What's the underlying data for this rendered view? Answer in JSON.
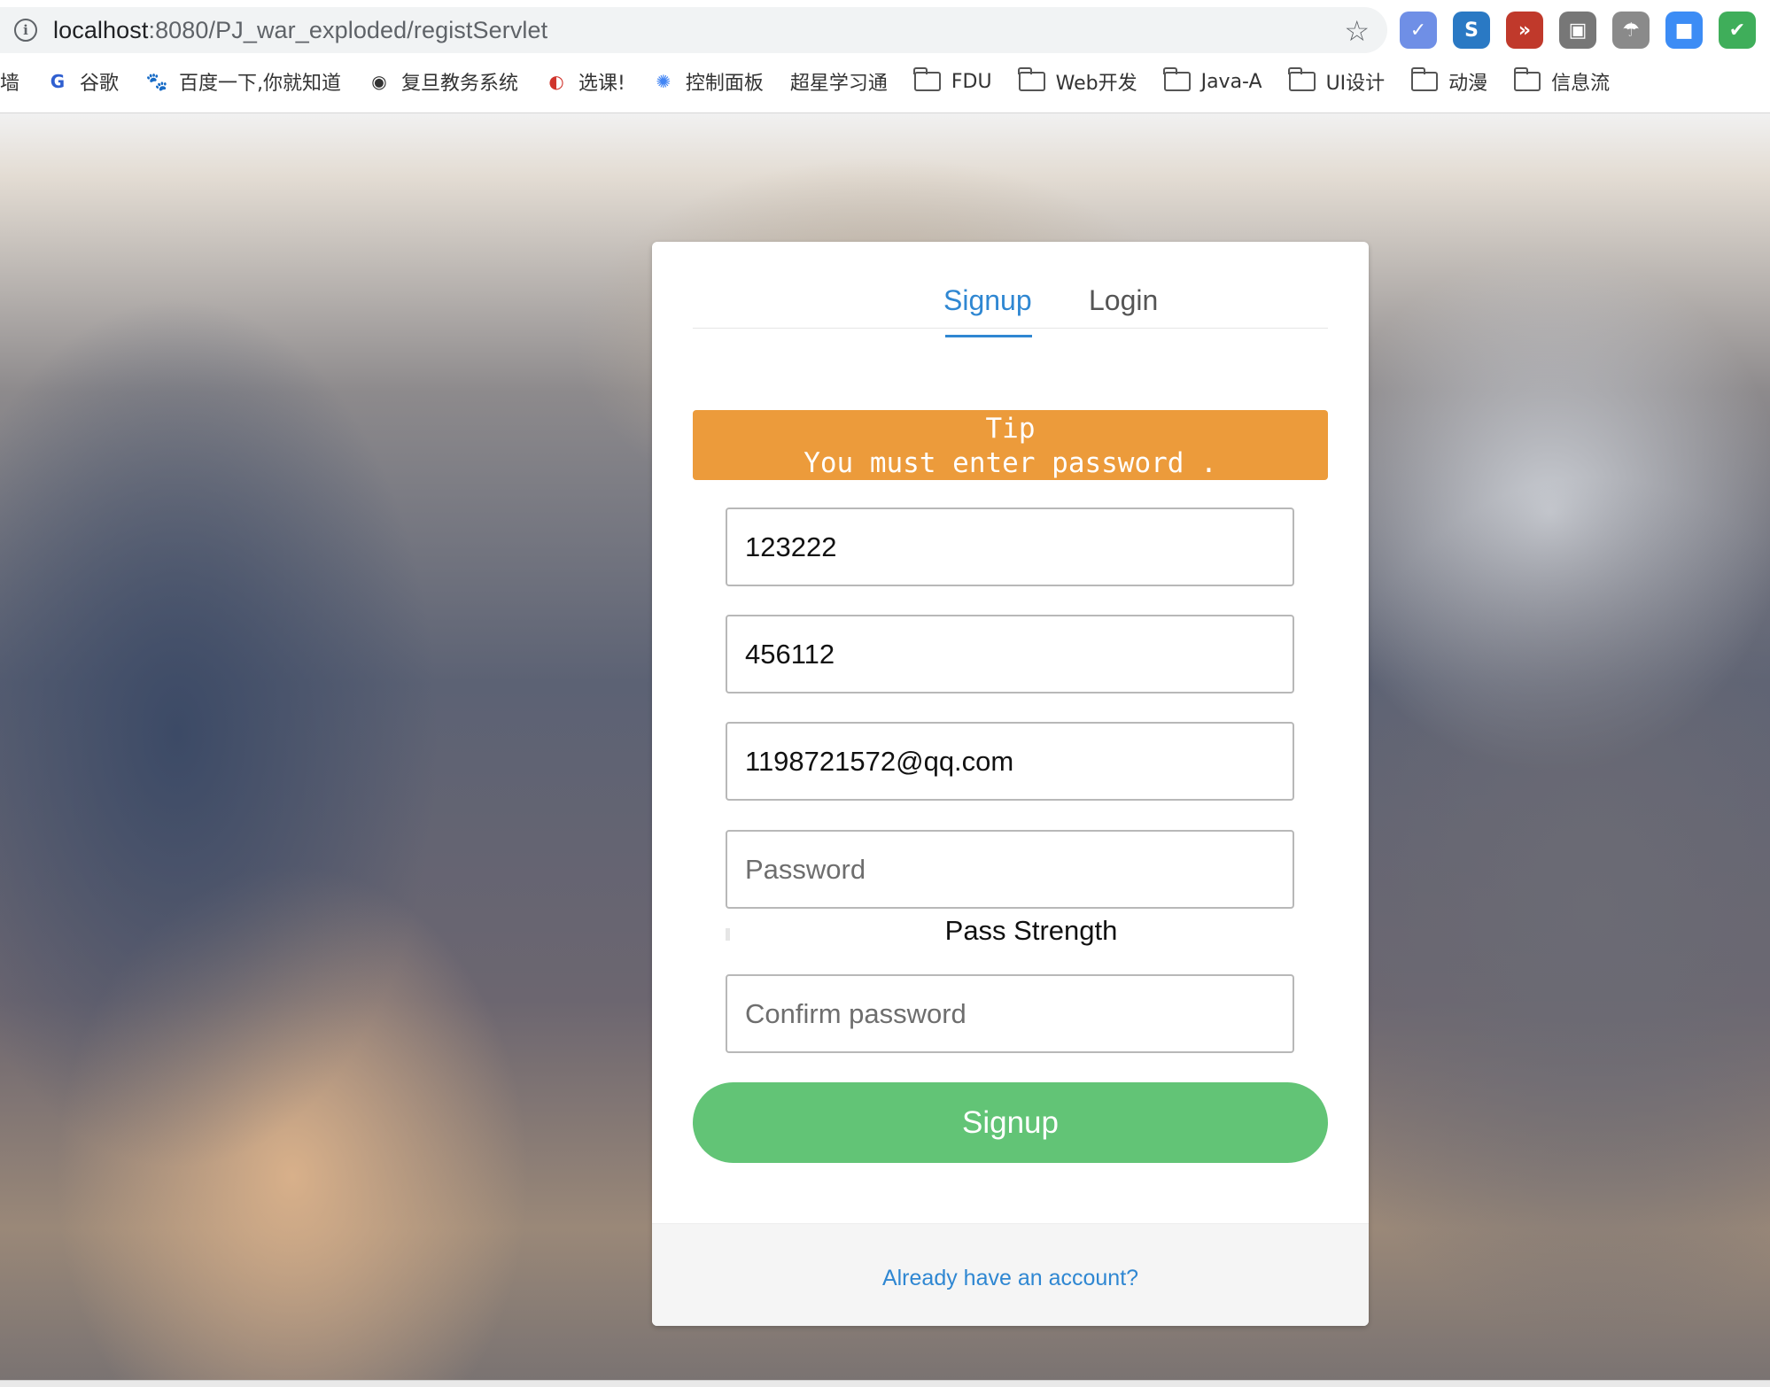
{
  "browser": {
    "url_host": "localhost",
    "url_path": ":8080/PJ_war_exploded/registServlet",
    "extensions": [
      {
        "name": "translate-extension",
        "glyph": "✓",
        "color": "#6f8fe6"
      },
      {
        "name": "s-extension",
        "glyph": "S",
        "color": "#2a79c4"
      },
      {
        "name": "forward-extension",
        "glyph": "»",
        "color": "#c0392b"
      },
      {
        "name": "cast-extension",
        "glyph": "▣",
        "color": "#777777"
      },
      {
        "name": "parachute-extension",
        "glyph": "☂",
        "color": "#8a8a8a"
      },
      {
        "name": "zoom-extension",
        "glyph": "■",
        "color": "#3c8cf5"
      },
      {
        "name": "shield-extension",
        "glyph": "✔",
        "color": "#3fae5a"
      }
    ],
    "bookmarks": [
      {
        "label": "翻墙",
        "type": "site",
        "icon": ""
      },
      {
        "label": "谷歌",
        "type": "site",
        "icon": "G"
      },
      {
        "label": "百度一下,你就知道",
        "type": "site",
        "icon": "🐾"
      },
      {
        "label": "复旦教务系统",
        "type": "site",
        "icon": "◉"
      },
      {
        "label": "选课!",
        "type": "site",
        "icon": "◐"
      },
      {
        "label": "控制面板",
        "type": "site",
        "icon": "✺"
      },
      {
        "label": "超星学习通",
        "type": "site",
        "icon": ""
      },
      {
        "label": "FDU",
        "type": "folder"
      },
      {
        "label": "Web开发",
        "type": "folder"
      },
      {
        "label": "Java-A",
        "type": "folder"
      },
      {
        "label": "UI设计",
        "type": "folder"
      },
      {
        "label": "动漫",
        "type": "folder"
      },
      {
        "label": "信息流",
        "type": "folder"
      }
    ]
  },
  "form": {
    "tabs": {
      "signup": "Signup",
      "login": "Login"
    },
    "tip": {
      "title": "Tip",
      "message": "You must enter password ."
    },
    "fields": {
      "username": {
        "value": "123222"
      },
      "second": {
        "value": "456112"
      },
      "email": {
        "value": "1198721572@qq.com"
      },
      "password": {
        "value": "",
        "placeholder": "Password"
      },
      "confirm": {
        "value": "",
        "placeholder": "Confirm password"
      }
    },
    "strength_label": "Pass Strength",
    "submit_label": "Signup",
    "footer_link": "Already have an account?"
  },
  "colors": {
    "accent": "#2f87d2",
    "tip_bg": "#ec9b3b",
    "button_bg": "#62c476"
  }
}
